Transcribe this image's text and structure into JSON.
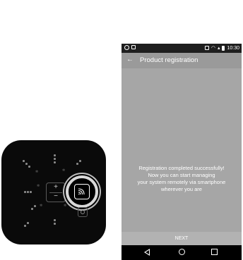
{
  "device": {
    "name": "thermostat",
    "plus": "+",
    "minus": "−",
    "icons": {
      "wifi": "wifi-icon",
      "settings": "circle-button-icon"
    }
  },
  "phone": {
    "status_bar": {
      "time": "10:30"
    },
    "app_bar": {
      "back": "←",
      "title": "Product registration"
    },
    "message": {
      "line1": "Registration completed successfully!",
      "line2": "Now you can start managing",
      "line3": "your system remotely via smartphone",
      "line4": "wherever you are"
    },
    "next_label": "NEXT",
    "colors": {
      "app_bar": "#9a9a9a",
      "content": "#a6a6a6",
      "next_bar": "#b2b2b2"
    }
  }
}
